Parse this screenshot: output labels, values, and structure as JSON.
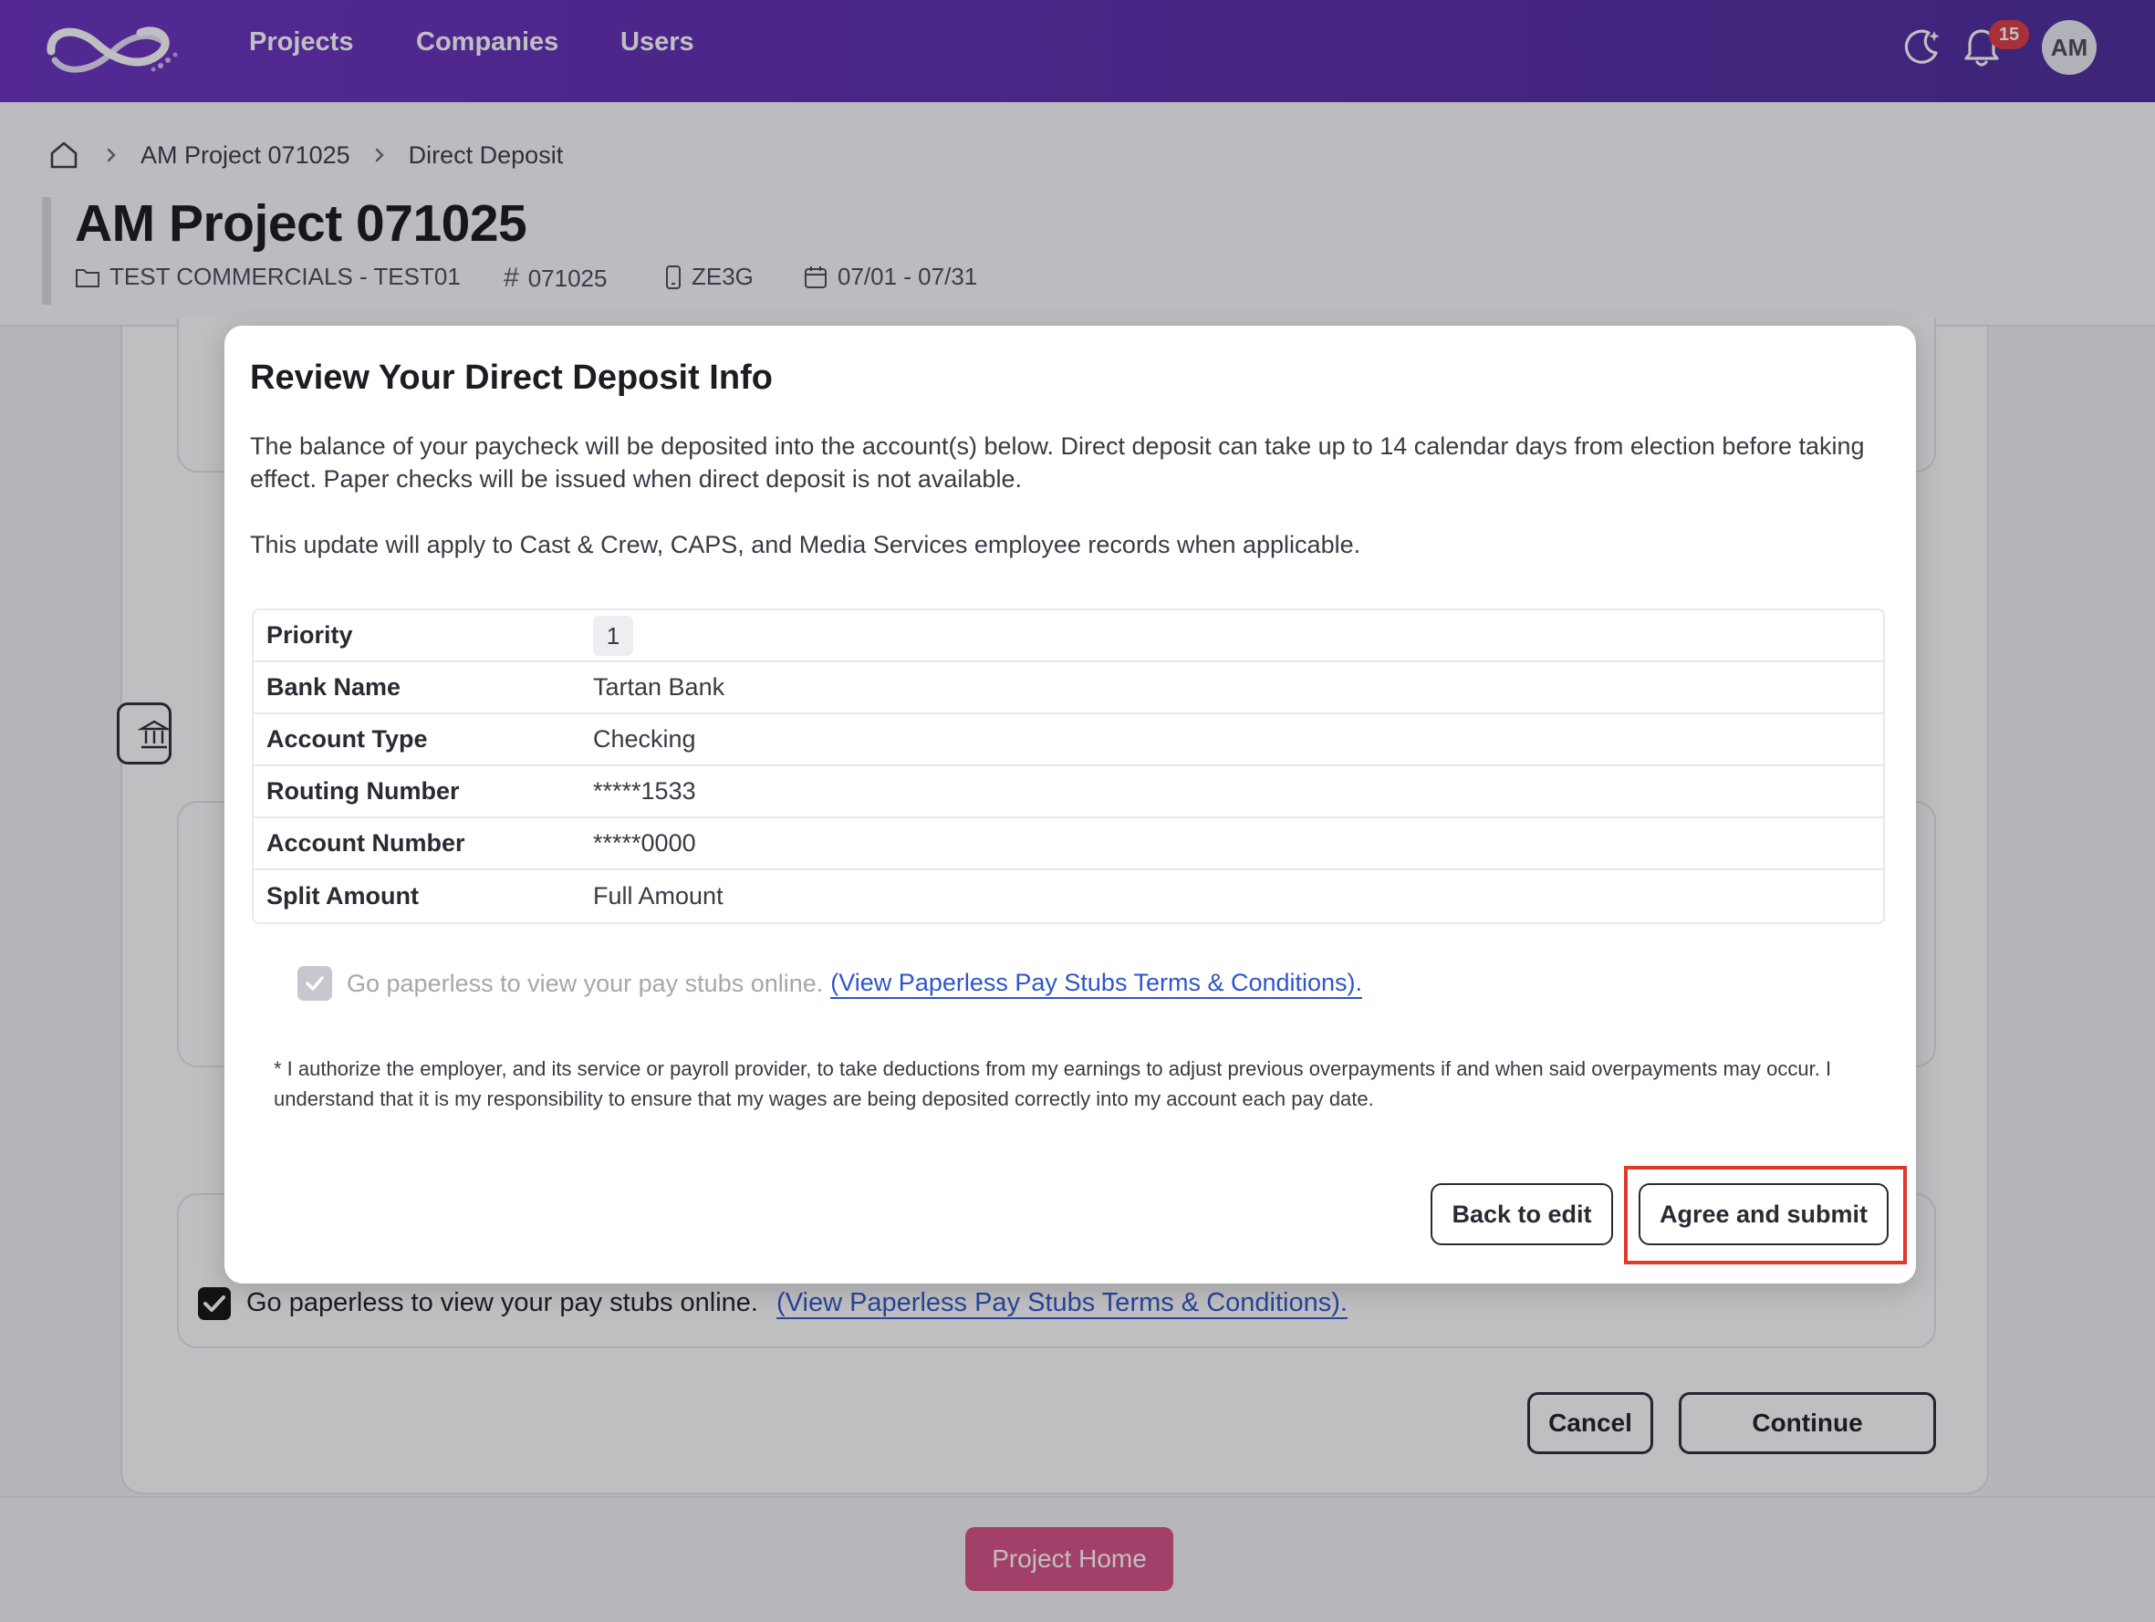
{
  "nav": {
    "links": [
      "Projects",
      "Companies",
      "Users"
    ],
    "notification_count": "15",
    "avatar_initials": "AM"
  },
  "breadcrumb": {
    "items": [
      "AM Project 071025",
      "Direct Deposit"
    ]
  },
  "header": {
    "title": "AM Project 071025",
    "company": "TEST COMMERCIALS - TEST01",
    "number": "071025",
    "code": "ZE3G",
    "dates": "07/01 - 07/31"
  },
  "background": {
    "paperless_text": "Go paperless to view your pay stubs online.",
    "paperless_link": "(View Paperless Pay Stubs Terms & Conditions).",
    "cancel_label": "Cancel",
    "continue_label": "Continue",
    "project_home_label": "Project Home"
  },
  "modal": {
    "title": "Review Your Direct Deposit Info",
    "paragraph1": "The balance of your paycheck will be deposited into the account(s) below. Direct deposit can take up to 14 calendar days from election before taking effect. Paper checks will be issued when direct deposit is not available.",
    "paragraph2": "This update will apply to Cast & Crew, CAPS, and Media Services employee records when applicable.",
    "rows": [
      {
        "label": "Priority",
        "value": "1"
      },
      {
        "label": "Bank Name",
        "value": "Tartan Bank"
      },
      {
        "label": "Account Type",
        "value": "Checking"
      },
      {
        "label": "Routing Number",
        "value": "*****1533"
      },
      {
        "label": "Account Number",
        "value": "*****0000"
      },
      {
        "label": "Split Amount",
        "value": "Full Amount"
      }
    ],
    "paperless_text": "Go paperless to view your pay stubs online.",
    "paperless_link": "(View Paperless Pay Stubs Terms & Conditions).",
    "disclaimer": "* I authorize the employer, and its service or payroll provider, to take deductions from my earnings to adjust previous overpayments if and when said overpayments may occur. I understand that it is my responsibility to ensure that my wages are being deposited correctly into my account each pay date.",
    "back_label": "Back to edit",
    "submit_label": "Agree and submit"
  },
  "colors": {
    "nav_gradient_start": "#6a2fbf",
    "nav_gradient_end": "#4a2a9a",
    "link": "#2f56c8",
    "project_home": "#d84f86",
    "highlight": "#e0392a"
  }
}
